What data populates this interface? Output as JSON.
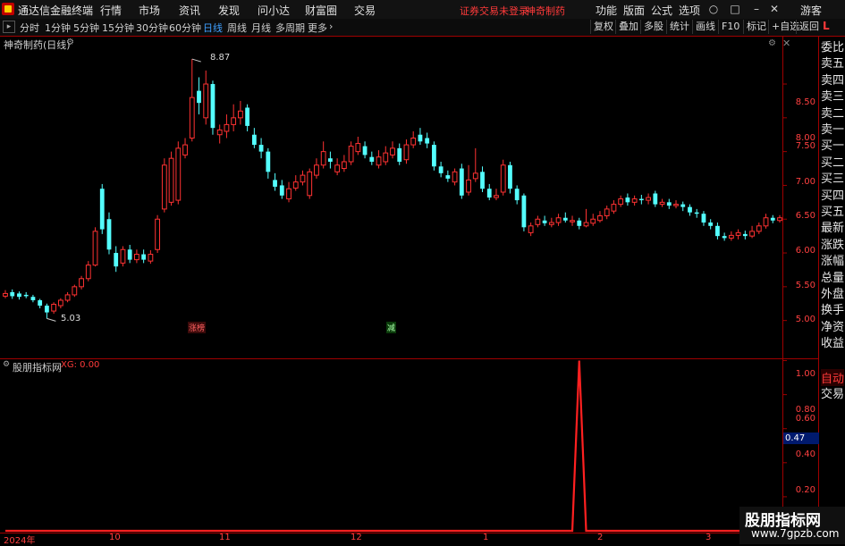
{
  "menubar": {
    "title": "通达信金融终端",
    "items": [
      "行情",
      "市场",
      "资讯",
      "发现",
      "问小达",
      "财富圈",
      "交易"
    ],
    "notice": "证券交易未登录",
    "stock_name": "神奇制药",
    "right_items": [
      "功能",
      "版面",
      "公式",
      "选项"
    ],
    "guest": "游客"
  },
  "toolbar": {
    "periods": [
      "分时",
      "1分钟",
      "5分钟",
      "15分钟",
      "30分钟",
      "60分钟",
      "日线",
      "周线",
      "月线",
      "多周期",
      "更多"
    ],
    "active_period": "日线",
    "buttons": [
      "复权",
      "叠加",
      "多股",
      "统计",
      "画线",
      "F10",
      "标记",
      "+自选",
      "返回"
    ]
  },
  "main_chart": {
    "title": "神奇制药(日线)",
    "high_label": "8.87",
    "low_label": "5.03",
    "tag_rise": "涨榜",
    "tag_reduce": "减",
    "y_ticks": [
      "8.50",
      "8.00",
      "7.50",
      "7.00",
      "6.50",
      "6.00",
      "5.50",
      "5.00"
    ]
  },
  "indicator": {
    "title": "股朋指标网",
    "xg_label": "XG: 0.00",
    "y_ticks": [
      "1.00",
      "0.80",
      "0.60",
      "0.40",
      "0.20"
    ],
    "current_value": "0.47"
  },
  "x_dates": [
    "2024年",
    "10",
    "11",
    "12",
    "1",
    "2",
    "3"
  ],
  "right_panel": {
    "corner": "L",
    "items": [
      "委比",
      "卖五",
      "卖四",
      "卖三",
      "卖二",
      "卖一",
      "买一",
      "买二",
      "买三",
      "买四",
      "买五",
      "最新",
      "涨跌",
      "涨幅",
      "总量",
      "外盘",
      "换手",
      "净资",
      "收益"
    ],
    "tabs": [
      "自动",
      "交易"
    ]
  },
  "watermark": {
    "line1": "股朋指标网",
    "line2": "www.7gpzb.com"
  },
  "colors": {
    "up": "#ff3232",
    "down": "#54ffff",
    "axis": "#a00000",
    "active": "#3fa0ff"
  },
  "chart_data": {
    "type": "candlestick",
    "title": "神奇制药(日线)",
    "ylim": [
      4.85,
      8.95
    ],
    "y_ticks": [
      5.0,
      5.5,
      6.0,
      6.5,
      7.0,
      7.5,
      8.0,
      8.5
    ],
    "candles": [
      {
        "o": 5.36,
        "c": 5.4,
        "h": 5.45,
        "l": 5.33
      },
      {
        "o": 5.42,
        "c": 5.36,
        "h": 5.46,
        "l": 5.32
      },
      {
        "o": 5.4,
        "c": 5.35,
        "h": 5.43,
        "l": 5.31
      },
      {
        "o": 5.38,
        "c": 5.36,
        "h": 5.42,
        "l": 5.33
      },
      {
        "o": 5.35,
        "c": 5.3,
        "h": 5.38,
        "l": 5.27
      },
      {
        "o": 5.3,
        "c": 5.22,
        "h": 5.32,
        "l": 5.18
      },
      {
        "o": 5.22,
        "c": 5.12,
        "h": 5.25,
        "l": 5.03
      },
      {
        "o": 5.14,
        "c": 5.24,
        "h": 5.27,
        "l": 5.1
      },
      {
        "o": 5.22,
        "c": 5.3,
        "h": 5.33,
        "l": 5.18
      },
      {
        "o": 5.3,
        "c": 5.38,
        "h": 5.42,
        "l": 5.27
      },
      {
        "o": 5.38,
        "c": 5.5,
        "h": 5.53,
        "l": 5.35
      },
      {
        "o": 5.5,
        "c": 5.62,
        "h": 5.66,
        "l": 5.46
      },
      {
        "o": 5.62,
        "c": 5.82,
        "h": 5.88,
        "l": 5.58
      },
      {
        "o": 5.82,
        "c": 6.32,
        "h": 6.38,
        "l": 5.8
      },
      {
        "o": 6.95,
        "c": 6.35,
        "h": 7.02,
        "l": 6.28
      },
      {
        "o": 6.5,
        "c": 6.05,
        "h": 6.6,
        "l": 5.98
      },
      {
        "o": 6.0,
        "c": 5.8,
        "h": 6.1,
        "l": 5.72
      },
      {
        "o": 5.85,
        "c": 6.05,
        "h": 6.1,
        "l": 5.8
      },
      {
        "o": 6.05,
        "c": 5.9,
        "h": 6.12,
        "l": 5.85
      },
      {
        "o": 5.9,
        "c": 5.98,
        "h": 6.05,
        "l": 5.85
      },
      {
        "o": 5.98,
        "c": 5.9,
        "h": 6.05,
        "l": 5.85
      },
      {
        "o": 5.88,
        "c": 5.98,
        "h": 6.04,
        "l": 5.84
      },
      {
        "o": 6.05,
        "c": 6.5,
        "h": 6.56,
        "l": 6.0
      },
      {
        "o": 6.65,
        "c": 7.3,
        "h": 7.4,
        "l": 6.6
      },
      {
        "o": 6.75,
        "c": 7.4,
        "h": 7.5,
        "l": 6.7
      },
      {
        "o": 6.78,
        "c": 7.55,
        "h": 7.65,
        "l": 6.72
      },
      {
        "o": 7.45,
        "c": 7.6,
        "h": 7.7,
        "l": 7.4
      },
      {
        "o": 7.7,
        "c": 8.3,
        "h": 8.87,
        "l": 7.65
      },
      {
        "o": 8.4,
        "c": 8.22,
        "h": 8.6,
        "l": 8.05
      },
      {
        "o": 8.0,
        "c": 8.5,
        "h": 8.7,
        "l": 7.9
      },
      {
        "o": 8.5,
        "c": 7.85,
        "h": 8.55,
        "l": 7.75
      },
      {
        "o": 7.75,
        "c": 7.82,
        "h": 7.9,
        "l": 7.62
      },
      {
        "o": 7.8,
        "c": 7.9,
        "h": 8.05,
        "l": 7.7
      },
      {
        "o": 7.9,
        "c": 8.0,
        "h": 8.2,
        "l": 7.8
      },
      {
        "o": 8.0,
        "c": 8.1,
        "h": 8.25,
        "l": 7.9
      },
      {
        "o": 8.15,
        "c": 7.88,
        "h": 8.2,
        "l": 7.8
      },
      {
        "o": 7.75,
        "c": 7.6,
        "h": 7.85,
        "l": 7.55
      },
      {
        "o": 7.6,
        "c": 7.5,
        "h": 7.7,
        "l": 7.4
      },
      {
        "o": 7.5,
        "c": 7.2,
        "h": 7.55,
        "l": 7.1
      },
      {
        "o": 7.08,
        "c": 6.98,
        "h": 7.18,
        "l": 6.92
      },
      {
        "o": 7.0,
        "c": 6.85,
        "h": 7.08,
        "l": 6.8
      },
      {
        "o": 6.8,
        "c": 6.95,
        "h": 7.05,
        "l": 6.75
      },
      {
        "o": 6.96,
        "c": 7.05,
        "h": 7.15,
        "l": 6.92
      },
      {
        "o": 7.05,
        "c": 7.15,
        "h": 7.22,
        "l": 7.0
      },
      {
        "o": 6.85,
        "c": 7.2,
        "h": 7.25,
        "l": 6.8
      },
      {
        "o": 7.15,
        "c": 7.3,
        "h": 7.4,
        "l": 7.1
      },
      {
        "o": 7.3,
        "c": 7.5,
        "h": 7.65,
        "l": 7.25
      },
      {
        "o": 7.4,
        "c": 7.35,
        "h": 7.5,
        "l": 7.25
      },
      {
        "o": 7.2,
        "c": 7.3,
        "h": 7.4,
        "l": 7.15
      },
      {
        "o": 7.25,
        "c": 7.35,
        "h": 7.45,
        "l": 7.2
      },
      {
        "o": 7.35,
        "c": 7.58,
        "h": 7.65,
        "l": 7.3
      },
      {
        "o": 7.5,
        "c": 7.62,
        "h": 7.72,
        "l": 7.45
      },
      {
        "o": 7.58,
        "c": 7.45,
        "h": 7.65,
        "l": 7.4
      },
      {
        "o": 7.42,
        "c": 7.35,
        "h": 7.5,
        "l": 7.3
      },
      {
        "o": 7.3,
        "c": 7.42,
        "h": 7.52,
        "l": 7.25
      },
      {
        "o": 7.35,
        "c": 7.48,
        "h": 7.58,
        "l": 7.3
      },
      {
        "o": 7.45,
        "c": 7.55,
        "h": 7.65,
        "l": 7.4
      },
      {
        "o": 7.55,
        "c": 7.35,
        "h": 7.62,
        "l": 7.3
      },
      {
        "o": 7.38,
        "c": 7.6,
        "h": 7.68,
        "l": 7.32
      },
      {
        "o": 7.6,
        "c": 7.7,
        "h": 7.8,
        "l": 7.55
      },
      {
        "o": 7.75,
        "c": 7.65,
        "h": 7.85,
        "l": 7.6
      },
      {
        "o": 7.7,
        "c": 7.62,
        "h": 7.78,
        "l": 7.55
      },
      {
        "o": 7.6,
        "c": 7.28,
        "h": 7.65,
        "l": 7.22
      },
      {
        "o": 7.28,
        "c": 7.18,
        "h": 7.35,
        "l": 7.12
      },
      {
        "o": 7.15,
        "c": 7.1,
        "h": 7.22,
        "l": 7.05
      },
      {
        "o": 7.05,
        "c": 7.2,
        "h": 7.25,
        "l": 7.0
      },
      {
        "o": 7.25,
        "c": 6.85,
        "h": 7.32,
        "l": 6.8
      },
      {
        "o": 6.9,
        "c": 7.08,
        "h": 7.3,
        "l": 6.85
      },
      {
        "o": 7.1,
        "c": 7.18,
        "h": 7.55,
        "l": 7.05
      },
      {
        "o": 7.2,
        "c": 6.95,
        "h": 7.28,
        "l": 6.9
      },
      {
        "o": 6.95,
        "c": 6.82,
        "h": 7.02,
        "l": 6.78
      },
      {
        "o": 6.82,
        "c": 6.85,
        "h": 6.95,
        "l": 6.78
      },
      {
        "o": 6.9,
        "c": 7.3,
        "h": 7.38,
        "l": 6.85
      },
      {
        "o": 7.3,
        "c": 6.95,
        "h": 7.35,
        "l": 6.88
      },
      {
        "o": 6.95,
        "c": 6.78,
        "h": 7.0,
        "l": 6.72
      },
      {
        "o": 6.85,
        "c": 6.38,
        "h": 6.88,
        "l": 6.32
      },
      {
        "o": 6.3,
        "c": 6.4,
        "h": 6.45,
        "l": 6.25
      },
      {
        "o": 6.42,
        "c": 6.5,
        "h": 6.55,
        "l": 6.38
      },
      {
        "o": 6.48,
        "c": 6.44,
        "h": 6.55,
        "l": 6.4
      },
      {
        "o": 6.42,
        "c": 6.45,
        "h": 6.52,
        "l": 6.38
      },
      {
        "o": 6.45,
        "c": 6.52,
        "h": 6.58,
        "l": 6.4
      },
      {
        "o": 6.52,
        "c": 6.48,
        "h": 6.6,
        "l": 6.45
      },
      {
        "o": 6.46,
        "c": 6.48,
        "h": 6.55,
        "l": 6.4
      },
      {
        "o": 6.48,
        "c": 6.4,
        "h": 6.52,
        "l": 6.35
      },
      {
        "o": 6.4,
        "c": 6.45,
        "h": 6.65,
        "l": 6.38
      },
      {
        "o": 6.44,
        "c": 6.5,
        "h": 6.58,
        "l": 6.4
      },
      {
        "o": 6.48,
        "c": 6.55,
        "h": 6.62,
        "l": 6.45
      },
      {
        "o": 6.55,
        "c": 6.65,
        "h": 6.7,
        "l": 6.5
      },
      {
        "o": 6.62,
        "c": 6.72,
        "h": 6.78,
        "l": 6.58
      },
      {
        "o": 6.72,
        "c": 6.8,
        "h": 6.85,
        "l": 6.68
      },
      {
        "o": 6.82,
        "c": 6.75,
        "h": 6.88,
        "l": 6.7
      },
      {
        "o": 6.75,
        "c": 6.8,
        "h": 6.85,
        "l": 6.7
      },
      {
        "o": 6.8,
        "c": 6.78,
        "h": 6.86,
        "l": 6.72
      },
      {
        "o": 6.78,
        "c": 6.82,
        "h": 6.88,
        "l": 6.72
      },
      {
        "o": 6.88,
        "c": 6.72,
        "h": 6.92,
        "l": 6.68
      },
      {
        "o": 6.72,
        "c": 6.75,
        "h": 6.8,
        "l": 6.68
      },
      {
        "o": 6.75,
        "c": 6.7,
        "h": 6.8,
        "l": 6.65
      },
      {
        "o": 6.7,
        "c": 6.72,
        "h": 6.78,
        "l": 6.66
      },
      {
        "o": 6.72,
        "c": 6.68,
        "h": 6.76,
        "l": 6.62
      },
      {
        "o": 6.68,
        "c": 6.6,
        "h": 6.72,
        "l": 6.55
      },
      {
        "o": 6.6,
        "c": 6.58,
        "h": 6.65,
        "l": 6.52
      },
      {
        "o": 6.58,
        "c": 6.45,
        "h": 6.62,
        "l": 6.4
      },
      {
        "o": 6.45,
        "c": 6.4,
        "h": 6.5,
        "l": 6.35
      },
      {
        "o": 6.4,
        "c": 6.25,
        "h": 6.45,
        "l": 6.2
      },
      {
        "o": 6.25,
        "c": 6.22,
        "h": 6.3,
        "l": 6.18
      },
      {
        "o": 6.22,
        "c": 6.26,
        "h": 6.32,
        "l": 6.18
      },
      {
        "o": 6.26,
        "c": 6.3,
        "h": 6.35,
        "l": 6.2
      },
      {
        "o": 6.28,
        "c": 6.25,
        "h": 6.33,
        "l": 6.2
      },
      {
        "o": 6.25,
        "c": 6.32,
        "h": 6.4,
        "l": 6.22
      },
      {
        "o": 6.32,
        "c": 6.4,
        "h": 6.45,
        "l": 6.28
      },
      {
        "o": 6.4,
        "c": 6.52,
        "h": 6.58,
        "l": 6.36
      },
      {
        "o": 6.52,
        "c": 6.48,
        "h": 6.56,
        "l": 6.44
      },
      {
        "o": 6.48,
        "c": 6.52,
        "h": 6.56,
        "l": 6.45
      }
    ],
    "indicator": {
      "name": "XG",
      "ylim": [
        0,
        1.05
      ],
      "peak_index": 83,
      "peak_value": 1.0
    }
  }
}
